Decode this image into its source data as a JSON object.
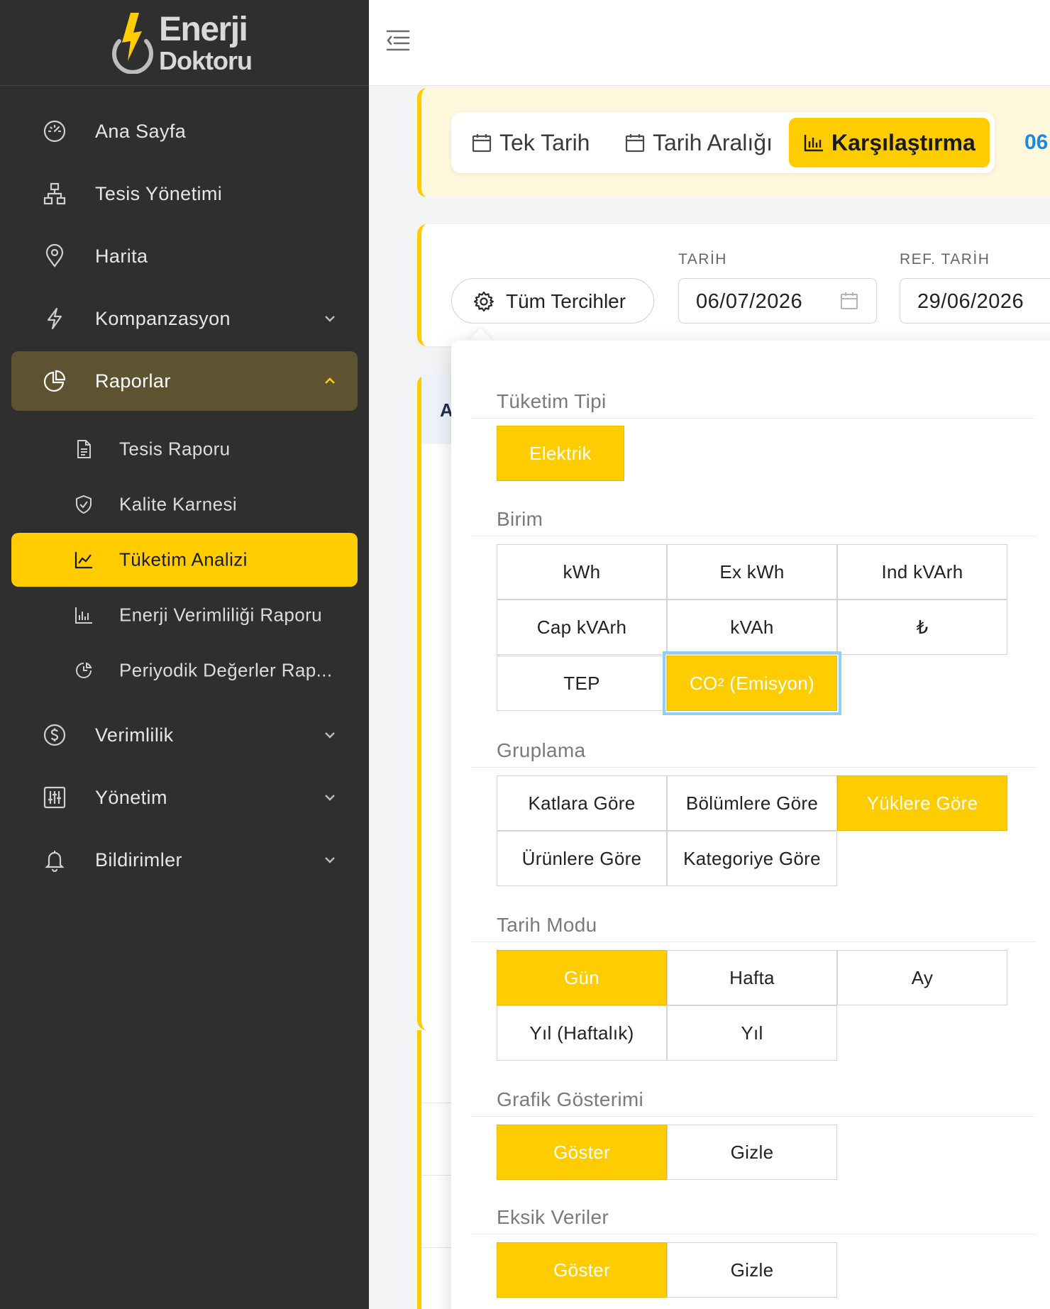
{
  "brand": {
    "line1": "Enerji",
    "line2": "Doktoru"
  },
  "sidebar": {
    "items": [
      {
        "label": "Ana Sayfa",
        "icon": "dashboard-gauge-icon"
      },
      {
        "label": "Tesis Yönetimi",
        "icon": "sitemap-icon"
      },
      {
        "label": "Harita",
        "icon": "map-pin-icon"
      },
      {
        "label": "Kompanzasyon",
        "icon": "lightning-icon"
      },
      {
        "label": "Raporlar",
        "icon": "pie-chart-icon"
      },
      {
        "label": "Verimlilik",
        "icon": "dollar-circle-icon"
      },
      {
        "label": "Yönetim",
        "icon": "sliders-icon"
      },
      {
        "label": "Bildirimler",
        "icon": "bell-icon"
      }
    ],
    "report_subitems": [
      {
        "label": "Tesis Raporu",
        "icon": "document-icon"
      },
      {
        "label": "Kalite Karnesi",
        "icon": "shield-check-icon"
      },
      {
        "label": "Tüketim Analizi",
        "icon": "line-chart-icon"
      },
      {
        "label": "Enerji Verimliliği Raporu",
        "icon": "bar-chart-icon"
      },
      {
        "label": "Periyodik Değerler Rap...",
        "icon": "clock-chart-icon"
      }
    ]
  },
  "date_tabs": [
    {
      "label": "Tek Tarih",
      "icon": "calendar-icon"
    },
    {
      "label": "Tarih Aralığı",
      "icon": "calendar-icon"
    },
    {
      "label": "Karşılaştırma",
      "icon": "bar-chart-icon"
    }
  ],
  "date_link": "06",
  "filters": {
    "preferences_label": "Tüm Tercihler",
    "date_label": "TARİH",
    "date_value": "06/07/2026",
    "ref_date_label": "REF. TARİH",
    "ref_date_value": "29/06/2026"
  },
  "bg_table_letter": "A",
  "preferences": {
    "consumption_type": {
      "title": "Tüketim Tipi",
      "options": [
        "Elektrik"
      ],
      "selected": "Elektrik"
    },
    "unit": {
      "title": "Birim",
      "options": [
        "kWh",
        "Ex kWh",
        "Ind kVArh",
        "Cap kVArh",
        "kVAh",
        "₺",
        "TEP"
      ],
      "co2": {
        "main": "CO",
        "sub": "2",
        "rest": " (Emisyon)"
      },
      "selected": "CO₂ (Emisyon)"
    },
    "grouping": {
      "title": "Gruplama",
      "options": [
        "Katlara Göre",
        "Bölümlere Göre",
        "Yüklere Göre",
        "Ürünlere Göre",
        "Kategoriye Göre"
      ],
      "selected": "Yüklere Göre"
    },
    "date_mode": {
      "title": "Tarih Modu",
      "options": [
        "Gün",
        "Hafta",
        "Ay",
        "Yıl (Haftalık)",
        "Yıl"
      ],
      "selected": "Gün"
    },
    "chart_display": {
      "title": "Grafik Gösterimi",
      "options": [
        "Göster",
        "Gizle"
      ],
      "selected": "Göster"
    },
    "missing_data": {
      "title": "Eksik Veriler",
      "options": [
        "Göster",
        "Gizle"
      ],
      "selected": "Göster"
    }
  },
  "colors": {
    "accent": "#ffcc00",
    "sidebar_bg": "#2f2f2f",
    "link": "#1e88e5"
  }
}
